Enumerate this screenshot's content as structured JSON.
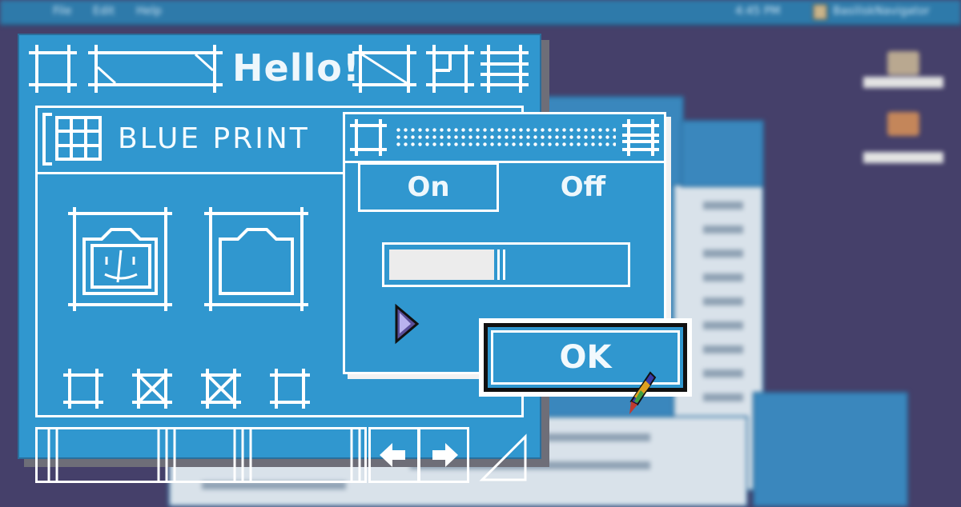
{
  "menubar": {
    "apple_glyph": "",
    "items": [
      "File",
      "Edit",
      "Help"
    ],
    "clock": "4:45 PM",
    "app_name": "BasiliskNavigator"
  },
  "main_window": {
    "title": "Hello!",
    "panel_title": "BLUE PRINT"
  },
  "dialog": {
    "on_label": "On",
    "off_label": "Off",
    "progress": 0.45,
    "ok_label": "OK"
  },
  "colors": {
    "desktop": "#45406a",
    "window_blue": "#3097cf",
    "line": "#ffffff",
    "menubar": "#2e7aaa"
  },
  "icons": [
    "apple-icon",
    "window-close-box-icon",
    "zoom-box-icon",
    "grid-icon",
    "finder-icon",
    "folder-icon",
    "checkbox-icon",
    "scroll-left-icon",
    "scroll-right-icon",
    "resize-icon",
    "pointer-icon",
    "feather-cursor-icon"
  ]
}
